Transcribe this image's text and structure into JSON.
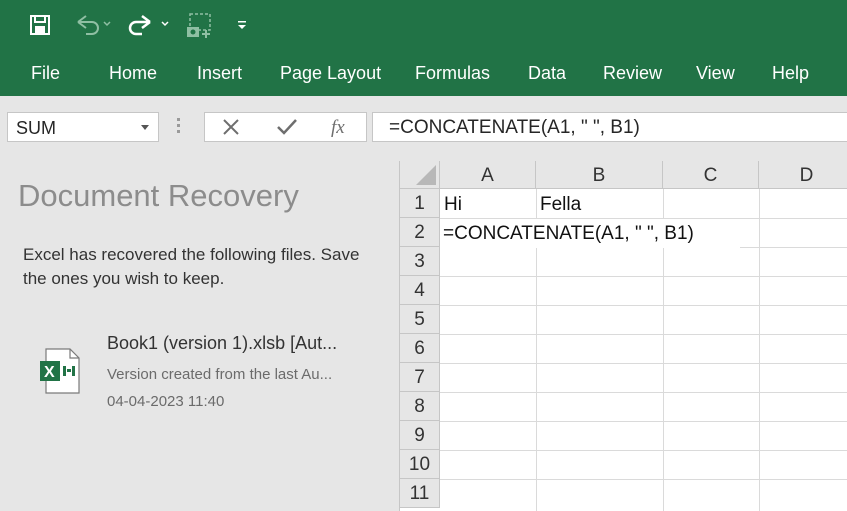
{
  "quick_access": {
    "save_icon": "save-icon",
    "undo_icon": "undo-icon",
    "redo_icon": "redo-icon",
    "screenshot_icon": "screenshot-icon",
    "customize_icon": "customize-qat-icon"
  },
  "ribbon": {
    "tabs": [
      "File",
      "Home",
      "Insert",
      "Page Layout",
      "Formulas",
      "Data",
      "Review",
      "View",
      "Help"
    ]
  },
  "formula_bar": {
    "name_box": "SUM",
    "cancel_icon": "cancel-icon",
    "enter_icon": "enter-checkmark-icon",
    "function_icon": "insert-function-icon",
    "formula": "=CONCATENATE(A1, \" \", B1)"
  },
  "recovery": {
    "title": "Document Recovery",
    "message": "Excel has recovered the following files.  Save the ones you wish to keep.",
    "files": [
      {
        "name": "Book1 (version 1).xlsb  [Aut...",
        "description": "Version created from the last Au...",
        "date": "04-04-2023 11:40"
      }
    ]
  },
  "grid": {
    "columns": [
      "A",
      "B",
      "C",
      "D"
    ],
    "rows": [
      "1",
      "2",
      "3",
      "4",
      "5",
      "6",
      "7",
      "8",
      "9",
      "10",
      "11"
    ],
    "cells": {
      "A1": "Hi",
      "B1": "Fella",
      "A2": "=CONCATENATE(A1, \" \", B1)"
    }
  },
  "colors": {
    "accent": "#217346",
    "pane_background": "#e6e6e6",
    "gridline": "#dadada"
  }
}
